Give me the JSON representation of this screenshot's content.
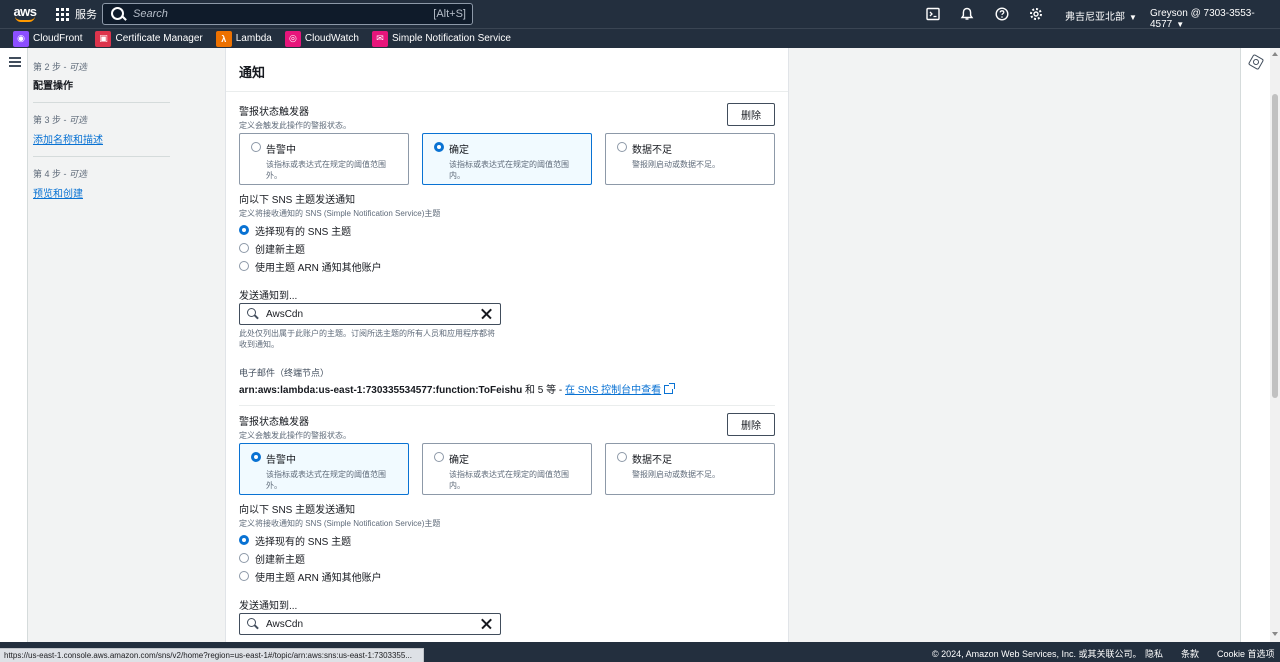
{
  "topnav": {
    "logo": "aws",
    "services_label": "服务",
    "search_placeholder": "Search",
    "search_shortcut": "[Alt+S]",
    "region": "弗吉尼亚北部",
    "account": "Greyson @ 7303-3553-4577"
  },
  "favorites": [
    {
      "label": "CloudFront",
      "icon": "cloudfront-icon",
      "color": "#8c4fff"
    },
    {
      "label": "Certificate Manager",
      "icon": "certificate-manager-icon",
      "color": "#dd344c"
    },
    {
      "label": "Lambda",
      "icon": "lambda-icon",
      "color": "#ed7100"
    },
    {
      "label": "CloudWatch",
      "icon": "cloudwatch-icon",
      "color": "#e7157b"
    },
    {
      "label": "Simple Notification Service",
      "icon": "sns-icon",
      "color": "#e7157b"
    }
  ],
  "steps": [
    {
      "step": "第 2 步 - ",
      "optional": "可选",
      "label": "配置操作",
      "current": true
    },
    {
      "step": "第 3 步 - ",
      "optional": "可选",
      "label": "添加名称和描述",
      "current": false
    },
    {
      "step": "第 4 步 - ",
      "optional": "可选",
      "label": "预览和创建",
      "current": false
    }
  ],
  "card": {
    "title": "通知"
  },
  "notifications": [
    {
      "trigger_title": "警报状态触发器",
      "trigger_desc": "定义会触发此操作的警报状态。",
      "delete_label": "删除",
      "tiles": [
        {
          "label": "告警中",
          "desc": "该指标或表达式在规定的阈值范围外。",
          "selected": false
        },
        {
          "label": "确定",
          "desc": "该指标或表达式在规定的阈值范围内。",
          "selected": true
        },
        {
          "label": "数据不足",
          "desc": "警报刚启动或数据不足。",
          "selected": false
        }
      ],
      "sns_title": "向以下 SNS 主题发送通知",
      "sns_desc": "定义将接收通知的 SNS (Simple Notification Service)主题",
      "sns_options": [
        {
          "label": "选择现有的 SNS 主题",
          "selected": true
        },
        {
          "label": "创建新主题",
          "selected": false
        },
        {
          "label": "使用主题 ARN 通知其他账户",
          "selected": false
        }
      ],
      "send_to_label": "发送通知到...",
      "send_to_value": "AwsCdn",
      "hint": "此处仅列出属于此账户的主题。订阅所选主题的所有人员和应用程序都将收到通知。",
      "email_label": "电子邮件（终端节点）",
      "arn": "arn:aws:lambda:us-east-1:730335534577:function:ToFeishu",
      "arn_more": " 和 5 等 - ",
      "arn_link": "在 SNS 控制台中查看"
    },
    {
      "trigger_title": "警报状态触发器",
      "trigger_desc": "定义会触发此操作的警报状态。",
      "delete_label": "删除",
      "tiles": [
        {
          "label": "告警中",
          "desc": "该指标或表达式在规定的阈值范围外。",
          "selected": true
        },
        {
          "label": "确定",
          "desc": "该指标或表达式在规定的阈值范围内。",
          "selected": false
        },
        {
          "label": "数据不足",
          "desc": "警报刚启动或数据不足。",
          "selected": false
        }
      ],
      "sns_title": "向以下 SNS 主题发送通知",
      "sns_desc": "定义将接收通知的 SNS (Simple Notification Service)主题",
      "sns_options": [
        {
          "label": "选择现有的 SNS 主题",
          "selected": true
        },
        {
          "label": "创建新主题",
          "selected": false
        },
        {
          "label": "使用主题 ARN 通知其他账户",
          "selected": false
        }
      ],
      "send_to_label": "发送通知到...",
      "send_to_value": "AwsCdn"
    }
  ],
  "footer": {
    "copyright": "© 2024, Amazon Web Services, Inc. 或其关联公司。",
    "privacy": "隐私",
    "terms": "条款",
    "cookie": "Cookie 首选项"
  },
  "status_url": "https://us-east-1.console.aws.amazon.com/sns/v2/home?region=us-east-1#/topic/arn:aws:sns:us-east-1:7303355..."
}
